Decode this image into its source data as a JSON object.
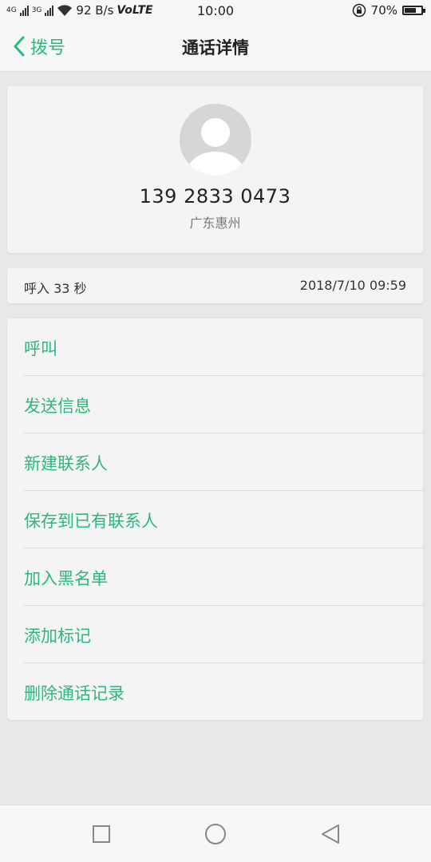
{
  "status_bar": {
    "network_left": "4G",
    "network_right": "3G",
    "speed": "92 B/s",
    "volte": "VoLTE",
    "time": "10:00",
    "battery": "70%",
    "battery_level": 0.7
  },
  "header": {
    "back_label": "拨号",
    "title": "通话详情"
  },
  "contact": {
    "phone": "139 2833 0473",
    "location": "广东惠州"
  },
  "call_info": {
    "type_duration": "呼入  33 秒",
    "datetime": "2018/7/10 09:59"
  },
  "actions": [
    {
      "label": "呼叫"
    },
    {
      "label": "发送信息"
    },
    {
      "label": "新建联系人"
    },
    {
      "label": "保存到已有联系人"
    },
    {
      "label": "加入黑名单"
    },
    {
      "label": "添加标记"
    },
    {
      "label": "删除通话记录"
    }
  ],
  "colors": {
    "accent": "#2bb87a",
    "background": "#e8e8e8",
    "card": "#f4f4f4"
  },
  "icons": {
    "nav": [
      "recent-apps-icon",
      "home-icon",
      "back-icon"
    ]
  }
}
